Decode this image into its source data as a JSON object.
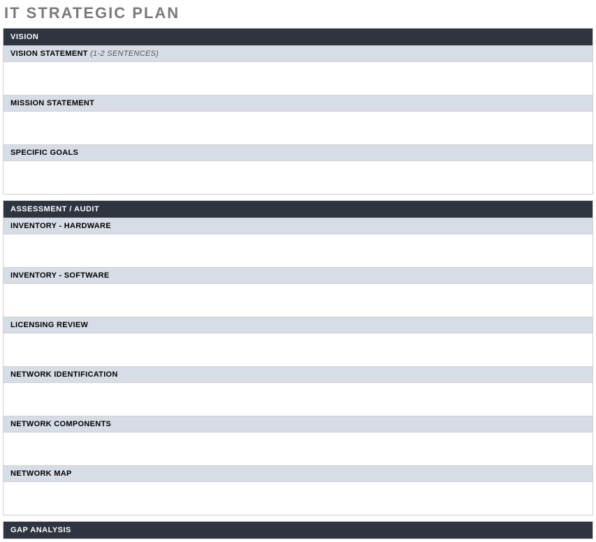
{
  "title": "IT STRATEGIC PLAN",
  "sections": {
    "vision": {
      "header": "VISION",
      "vision_statement_label": "VISION STATEMENT",
      "vision_statement_hint": "(1-2 SENTENCES)",
      "mission_statement_label": "MISSION STATEMENT",
      "specific_goals_label": "SPECIFIC GOALS"
    },
    "assessment": {
      "header": "ASSESSMENT / AUDIT",
      "inventory_hardware_label": "INVENTORY - HARDWARE",
      "inventory_software_label": "INVENTORY - SOFTWARE",
      "licensing_review_label": "LICENSING REVIEW",
      "network_identification_label": "NETWORK IDENTIFICATION",
      "network_components_label": "NETWORK COMPONENTS",
      "network_map_label": "NETWORK MAP"
    },
    "gap_analysis": {
      "header": "GAP ANALYSIS"
    }
  }
}
